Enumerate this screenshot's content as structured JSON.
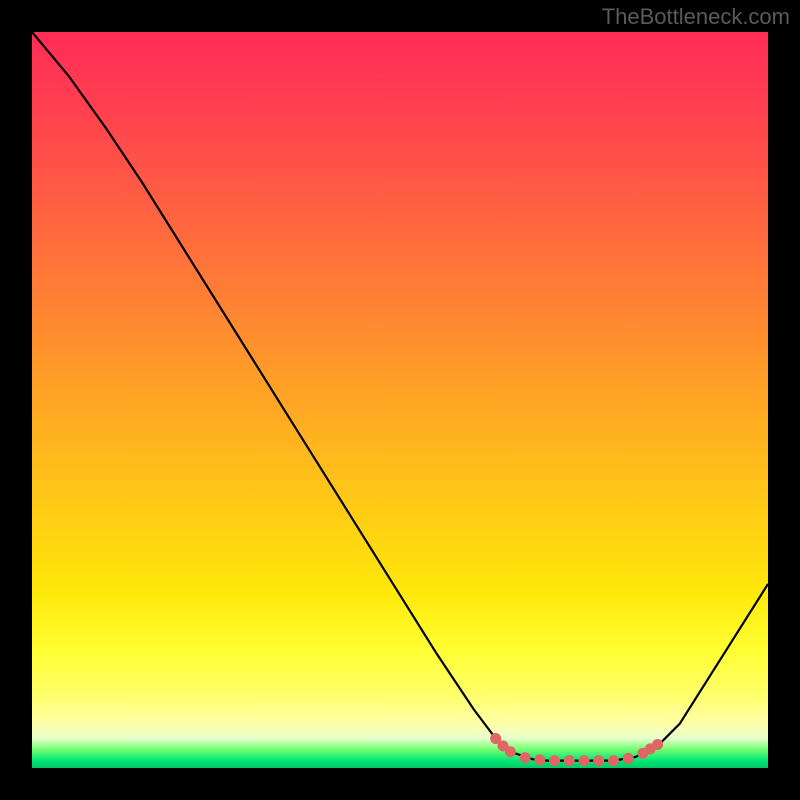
{
  "attribution": "TheBottleneck.com",
  "chart_data": {
    "type": "line",
    "title": "",
    "xlabel": "",
    "ylabel": "",
    "xlim": [
      0,
      100
    ],
    "ylim": [
      0,
      100
    ],
    "series": [
      {
        "name": "bottleneck-curve",
        "x": [
          0,
          5,
          10,
          15,
          20,
          25,
          30,
          35,
          40,
          45,
          50,
          55,
          60,
          63,
          65,
          68,
          70,
          73,
          76,
          79,
          82,
          85,
          88,
          100
        ],
        "y": [
          100,
          94,
          87,
          79.5,
          71.5,
          63.5,
          55.5,
          47.5,
          39.5,
          31.5,
          23.5,
          15.5,
          8,
          4,
          2.2,
          1.2,
          1,
          1,
          1,
          1,
          1.5,
          3,
          6,
          25
        ]
      }
    ],
    "markers": {
      "name": "optimal-range-markers",
      "color": "#e06666",
      "points": [
        {
          "x": 63,
          "y": 4.0
        },
        {
          "x": 64,
          "y": 3.0
        },
        {
          "x": 65,
          "y": 2.2
        },
        {
          "x": 67,
          "y": 1.4
        },
        {
          "x": 69,
          "y": 1.1
        },
        {
          "x": 71,
          "y": 1.0
        },
        {
          "x": 73,
          "y": 1.0
        },
        {
          "x": 75,
          "y": 1.0
        },
        {
          "x": 77,
          "y": 1.0
        },
        {
          "x": 79,
          "y": 1.0
        },
        {
          "x": 81,
          "y": 1.3
        },
        {
          "x": 83,
          "y": 2.0
        },
        {
          "x": 84,
          "y": 2.6
        },
        {
          "x": 85,
          "y": 3.2
        }
      ]
    },
    "gradient_stops": [
      {
        "pos": 0,
        "color": "#ff2d55"
      },
      {
        "pos": 50,
        "color": "#ffa026"
      },
      {
        "pos": 85,
        "color": "#ffff33"
      },
      {
        "pos": 97,
        "color": "#70ff70"
      },
      {
        "pos": 100,
        "color": "#00c864"
      }
    ]
  }
}
